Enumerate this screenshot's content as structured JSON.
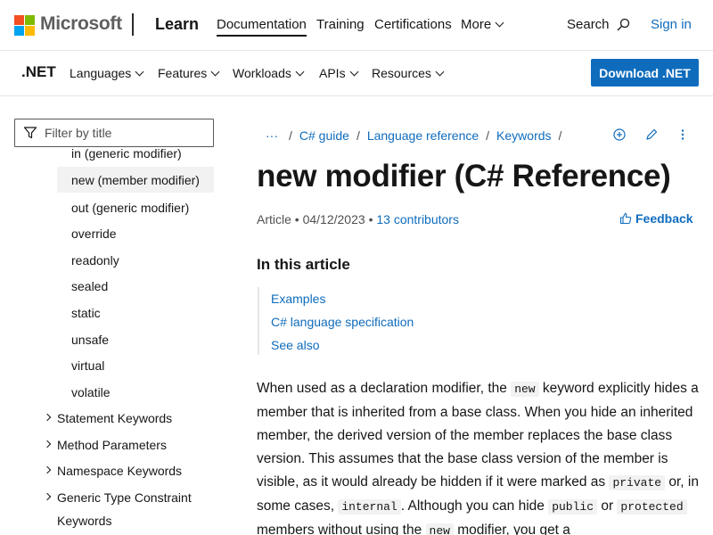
{
  "header": {
    "brand": "Microsoft",
    "product": "Learn",
    "nav": [
      {
        "label": "Documentation",
        "active": true
      },
      {
        "label": "Training",
        "active": false
      },
      {
        "label": "Certifications",
        "active": false
      },
      {
        "label": "More",
        "active": false
      }
    ],
    "search_label": "Search",
    "signin_label": "Sign in"
  },
  "subheader": {
    "title": ".NET",
    "nav": [
      "Languages",
      "Features",
      "Workloads",
      "APIs",
      "Resources"
    ],
    "download_label": "Download .NET"
  },
  "sidebar": {
    "filter_placeholder": "Filter by title",
    "items": [
      {
        "label": "in (generic modifier)"
      },
      {
        "label": "new (member modifier)",
        "selected": true
      },
      {
        "label": "out (generic modifier)"
      },
      {
        "label": "override"
      },
      {
        "label": "readonly"
      },
      {
        "label": "sealed"
      },
      {
        "label": "static"
      },
      {
        "label": "unsafe"
      },
      {
        "label": "virtual"
      },
      {
        "label": "volatile"
      }
    ],
    "groups": [
      {
        "label": "Statement Keywords"
      },
      {
        "label": "Method Parameters"
      },
      {
        "label": "Namespace Keywords"
      },
      {
        "label": "Generic Type Constraint",
        "label2": "Keywords"
      }
    ]
  },
  "breadcrumb": {
    "more": "···",
    "items": [
      "C# guide",
      "Language reference",
      "Keywords"
    ]
  },
  "article": {
    "title": "new modifier (C# Reference)",
    "type": "Article",
    "date": "04/12/2023",
    "contributors": "13 contributors",
    "feedback_label": "Feedback",
    "in_this_article": "In this article",
    "toc": [
      "Examples",
      "C# language specification",
      "See also"
    ],
    "body": {
      "t1": "When used as a declaration modifier, the ",
      "c1": "new",
      "t2": " keyword explicitly hides a member that is inherited from a base class. When you hide an inherited member, the derived version of the member replaces the base class version. This assumes that the base class version of the member is visible, as it would already be hidden if it were marked as ",
      "c2": "private",
      "t3": " or, in some cases, ",
      "c3": "internal",
      "t4": ". Although you can hide ",
      "c4": "public",
      "t5": " or ",
      "c5": "protected",
      "t6": " members without using the ",
      "c6": "new",
      "t7": " modifier, you get a"
    }
  },
  "colors": {
    "accent": "#0f6cbd",
    "text": "#161616",
    "muted": "#505050"
  }
}
